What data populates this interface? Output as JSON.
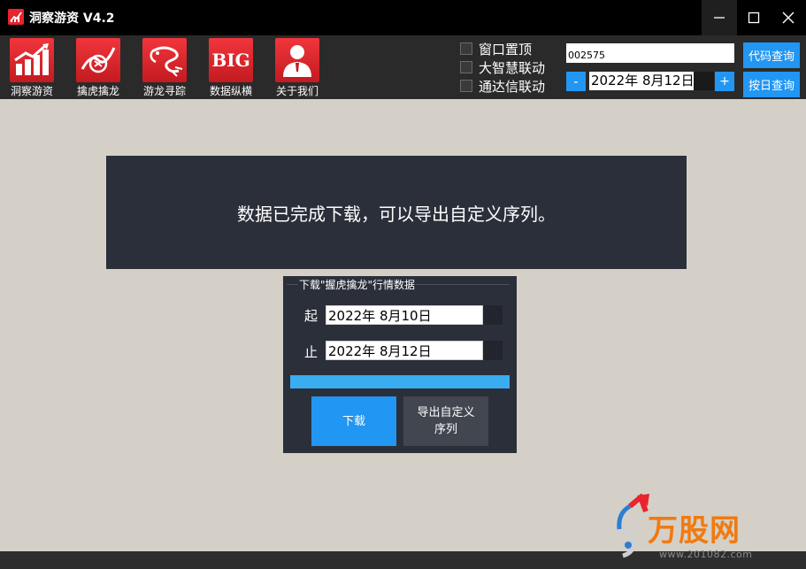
{
  "window": {
    "title": "洞察游资 V4.2",
    "controls": {
      "minimize": "—",
      "maximize": "☐",
      "close": "✕"
    }
  },
  "toolbar": {
    "tools": [
      {
        "label": "洞察游资",
        "icon": "rising-bar-chart-icon"
      },
      {
        "label": "擒虎擒龙",
        "icon": "tiger-trend-icon"
      },
      {
        "label": "游龙寻踪",
        "icon": "dragon-icon"
      },
      {
        "label": "数据纵横",
        "icon": "big-data-icon",
        "icon_text": "BIG"
      },
      {
        "label": "关于我们",
        "icon": "person-icon"
      }
    ]
  },
  "options": [
    {
      "label": "窗口置顶",
      "checked": false
    },
    {
      "label": "大智慧联动",
      "checked": false
    },
    {
      "label": "通达信联动",
      "checked": false
    }
  ],
  "code_search": {
    "value": "002575",
    "button": "代码查询"
  },
  "date_search": {
    "minus": "-",
    "value": "2022年  8月12日",
    "plus": "+",
    "button": "按日查询"
  },
  "banner": {
    "message": "数据已完成下载，可以导出自定义序列。"
  },
  "download_panel": {
    "legend": "下载\"握虎擒龙\"行情数据",
    "start_label": "起",
    "start_date": "2022年  8月10日",
    "end_label": "止",
    "end_date": "2022年  8月12日",
    "progress": 1.0,
    "download_button": "下载",
    "export_button_line1": "导出自定义",
    "export_button_line2": "序列"
  },
  "watermark": {
    "text": "万股网",
    "url": "www.201082.com"
  },
  "colors": {
    "accent_blue": "#2196f3",
    "progress_blue": "#3aacf0",
    "tile_red": "#e8242c",
    "panel_dark": "#2b2f3a",
    "watermark_orange": "#f07a12"
  }
}
